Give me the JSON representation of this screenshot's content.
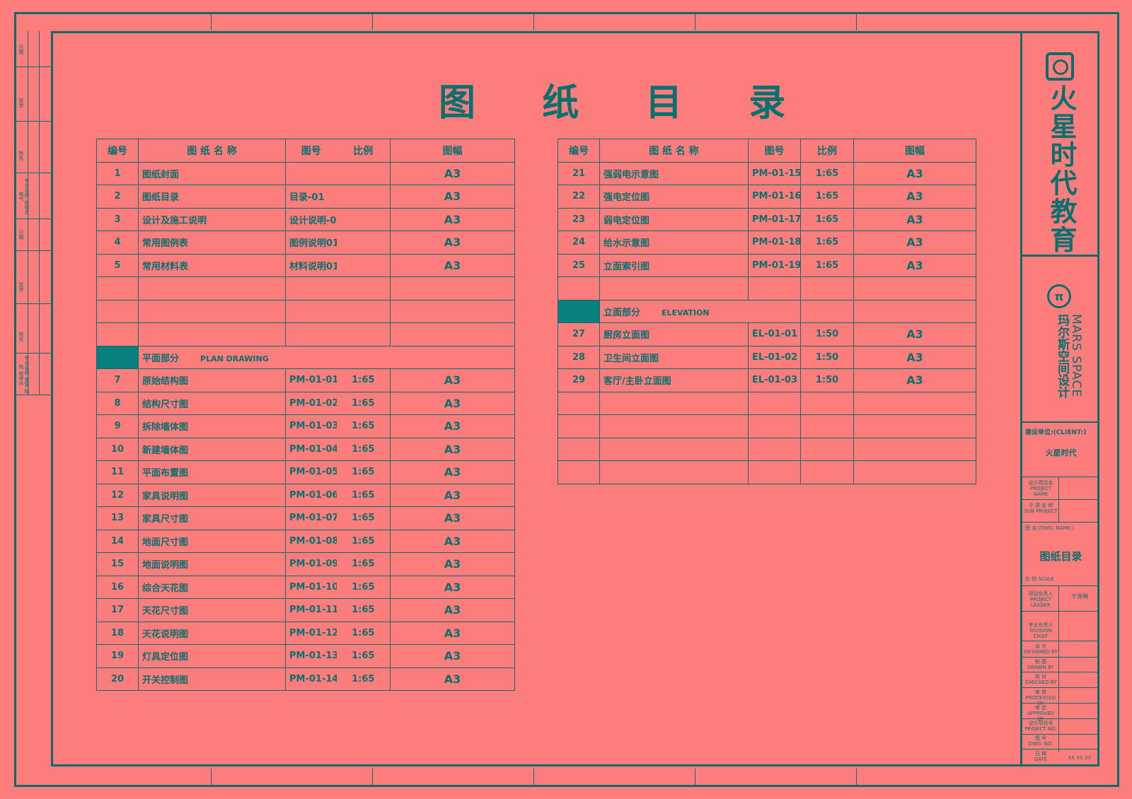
{
  "title": "图 纸 目 录",
  "left_table": {
    "headers": [
      "编号",
      "图 纸 名 称",
      "图号",
      "比例",
      "图幅"
    ],
    "rows": [
      {
        "no": "1",
        "name": "图纸封面",
        "code": "",
        "scale": "",
        "size": "A3"
      },
      {
        "no": "2",
        "name": "图纸目录",
        "code": "目录-01",
        "scale": "",
        "size": "A3"
      },
      {
        "no": "3",
        "name": "设计及施工说明",
        "code": "设计说明-01",
        "scale": "",
        "size": "A3"
      },
      {
        "no": "4",
        "name": "常用图例表",
        "code": "图例说明01",
        "scale": "",
        "size": "A3"
      },
      {
        "no": "5",
        "name": "常用材料表",
        "code": "材料说明01",
        "scale": "",
        "size": "A3"
      },
      {
        "no": "",
        "name": "",
        "code": "",
        "scale": "",
        "size": ""
      },
      {
        "no": "",
        "name": "",
        "code": "",
        "scale": "",
        "size": ""
      },
      {
        "no": "",
        "name": "",
        "code": "",
        "scale": "",
        "size": ""
      }
    ],
    "section": {
      "name": "平面部分",
      "en": "PLAN DRAWING"
    },
    "rows2": [
      {
        "no": "7",
        "name": "原始结构图",
        "code": "PM-01-01",
        "scale": "1:65",
        "size": "A3"
      },
      {
        "no": "8",
        "name": "结构尺寸图",
        "code": "PM-01-02",
        "scale": "1:65",
        "size": "A3"
      },
      {
        "no": "9",
        "name": "拆除墙体图",
        "code": "PM-01-03",
        "scale": "1:65",
        "size": "A3"
      },
      {
        "no": "10",
        "name": "新建墙体图",
        "code": "PM-01-04",
        "scale": "1:65",
        "size": "A3"
      },
      {
        "no": "11",
        "name": "平面布置图",
        "code": "PM-01-05",
        "scale": "1:65",
        "size": "A3"
      },
      {
        "no": "12",
        "name": "家具说明图",
        "code": "PM-01-06",
        "scale": "1:65",
        "size": "A3"
      },
      {
        "no": "13",
        "name": "家具尺寸图",
        "code": "PM-01-07",
        "scale": "1:65",
        "size": "A3"
      },
      {
        "no": "14",
        "name": "地面尺寸图",
        "code": "PM-01-08",
        "scale": "1:65",
        "size": "A3"
      },
      {
        "no": "15",
        "name": "地面说明图",
        "code": "PM-01-09",
        "scale": "1:65",
        "size": "A3"
      },
      {
        "no": "16",
        "name": "综合天花图",
        "code": "PM-01-10",
        "scale": "1:65",
        "size": "A3"
      },
      {
        "no": "17",
        "name": "天花尺寸图",
        "code": "PM-01-11",
        "scale": "1:65",
        "size": "A3"
      },
      {
        "no": "18",
        "name": "天花说明图",
        "code": "PM-01-12",
        "scale": "1:65",
        "size": "A3"
      },
      {
        "no": "19",
        "name": "灯具定位图",
        "code": "PM-01-13",
        "scale": "1:65",
        "size": "A3"
      },
      {
        "no": "20",
        "name": "开关控制图",
        "code": "PM-01-14",
        "scale": "1:65",
        "size": "A3"
      }
    ]
  },
  "right_table": {
    "headers": [
      "编号",
      "图 纸 名 称",
      "图号",
      "比例",
      "图幅"
    ],
    "rows": [
      {
        "no": "21",
        "name": "强弱电示意图",
        "code": "PM-01-15",
        "scale": "1:65",
        "size": "A3"
      },
      {
        "no": "22",
        "name": "强电定位图",
        "code": "PM-01-16",
        "scale": "1:65",
        "size": "A3"
      },
      {
        "no": "23",
        "name": "弱电定位图",
        "code": "PM-01-17",
        "scale": "1:65",
        "size": "A3"
      },
      {
        "no": "24",
        "name": "给水示意图",
        "code": "PM-01-18",
        "scale": "1:65",
        "size": "A3"
      },
      {
        "no": "25",
        "name": "立面索引图",
        "code": "PM-01-19",
        "scale": "1:65",
        "size": "A3"
      },
      {
        "no": "",
        "name": "",
        "code": "",
        "scale": "",
        "size": ""
      }
    ],
    "section": {
      "name": "立面部分",
      "en": "ELEVATION"
    },
    "rows2": [
      {
        "no": "27",
        "name": "厨房立面图",
        "code": "EL-01-01",
        "scale": "1:50",
        "size": "A3"
      },
      {
        "no": "28",
        "name": "卫生间立面图",
        "code": "EL-01-02",
        "scale": "1:50",
        "size": "A3"
      },
      {
        "no": "29",
        "name": "客厅/主卧立面图",
        "code": "EL-01-03",
        "scale": "1:50",
        "size": "A3"
      },
      {
        "no": "",
        "name": "",
        "code": "",
        "scale": "",
        "size": ""
      },
      {
        "no": "",
        "name": "",
        "code": "",
        "scale": "",
        "size": ""
      },
      {
        "no": "",
        "name": "",
        "code": "",
        "scale": "",
        "size": ""
      },
      {
        "no": "",
        "name": "",
        "code": "",
        "scale": "",
        "size": ""
      }
    ]
  },
  "title_block": {
    "brand": "火星时代教育",
    "partner_en": "MARS SPACE",
    "partner_cn": "玛尔斯空间设计",
    "client_label": "建设单位:(CLIENT:)",
    "client_value": "火星时代",
    "project_label_cn": "设计项目名",
    "project_label_en": "PROJECT NAME",
    "sub_label_cn": "子 项 名 称",
    "sub_label_en": "SUB PROJECT",
    "dwg_label": "图  名:(DWG. NAME:)",
    "dwg_value": "图纸目录",
    "scale_label": "比 例  SCALE",
    "leader_cn": "项目负责人",
    "leader_en": "PROJECT LEADER",
    "leader_value": "于源琳",
    "division_cn": "专业负责人",
    "division_en": "DIVISION CHIEF",
    "designed_cn": "设  计",
    "designed_en": "DESIGNED BY",
    "drawn_cn": "制  图",
    "drawn_en": "DRAWN BY",
    "checked_cn": "校  对",
    "checked_en": "CHECKED BY",
    "processed_cn": "审  核",
    "processed_en": "PROCESSED BY",
    "approved_cn": "审  定",
    "approved_en": "APPROVED BY",
    "projno_cn": "设计项目号",
    "projno_en": "PROJECT NO.",
    "dwgno_cn": "图  号",
    "dwgno_en": "DWG.  NO.",
    "date_cn": "日  期",
    "date_en": "DATE",
    "date_value": "XX XX XX"
  },
  "left_strip": {
    "labels": [
      "日期",
      "签字",
      "姓名",
      "专业名称  给排水  电气",
      "日期",
      "签字",
      "姓名",
      "专业名称  建筑  结构  给排水"
    ]
  }
}
